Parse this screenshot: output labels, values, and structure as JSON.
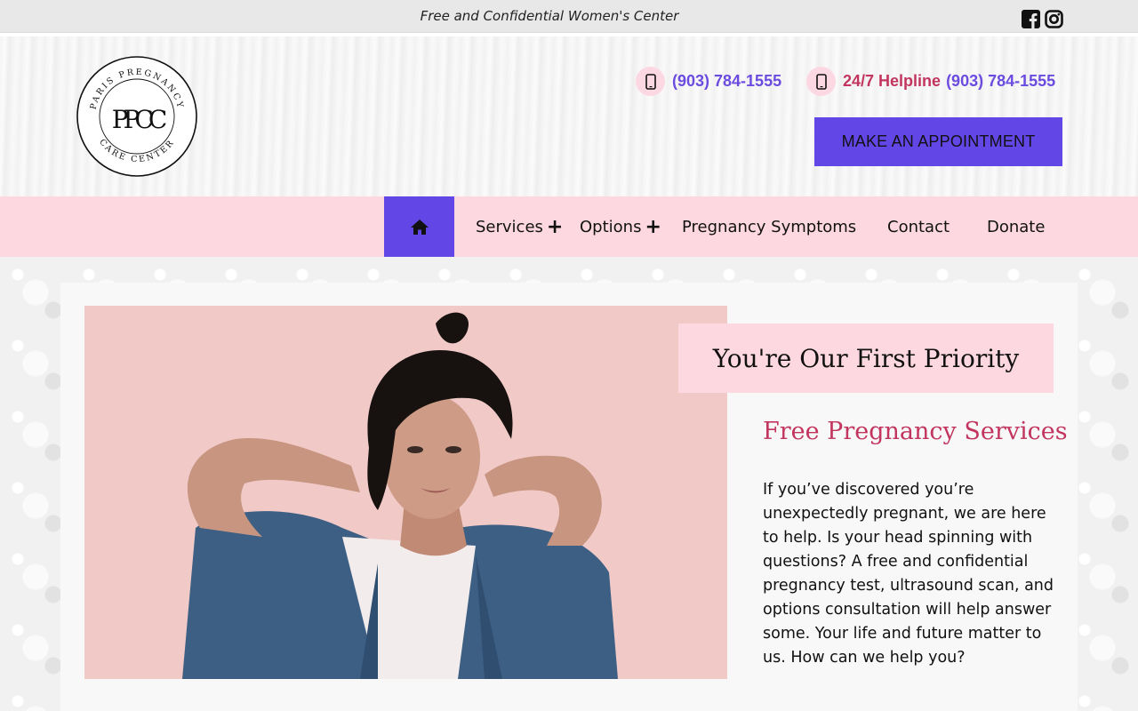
{
  "topbar": {
    "tagline": "Free and Confidential Women's Center",
    "social_icons": [
      "facebook-icon",
      "instagram-icon"
    ]
  },
  "header": {
    "logo_text": {
      "ring_top": "PARIS PREGNANCY",
      "ring_bottom": "CARE CENTER",
      "monogram": "PPCC"
    },
    "phone_number": "(903) 784-1555",
    "helpline_label": "24/7 Helpline",
    "helpline_number": "(903) 784-1555",
    "appointment_button": "MAKE AN APPOINTMENT"
  },
  "nav": {
    "home_icon": "home-icon",
    "items": [
      {
        "label": "Services",
        "has_submenu": true
      },
      {
        "label": "Options",
        "has_submenu": true
      },
      {
        "label": "Pregnancy Symptoms",
        "has_submenu": false
      },
      {
        "label": "Contact",
        "has_submenu": false
      },
      {
        "label": "Donate",
        "has_submenu": false
      }
    ],
    "plus_symbol": "+"
  },
  "main": {
    "priority_heading": "You're Our First Priority",
    "subheading": "Free Pregnancy Services",
    "body": "If you’ve discovered you’re unexpectedly pregnant, we are here to help. Is your head spinning with questions? A free and confidential pregnancy test, ultrasound scan, and options consultation will help answer some. Your life and future matter to us. How can we help you?"
  },
  "colors": {
    "accent_purple": "#6247e6",
    "accent_pink": "#fdd8e1",
    "heading_red": "#c2355f",
    "phone_purple": "#6b4cdf"
  }
}
